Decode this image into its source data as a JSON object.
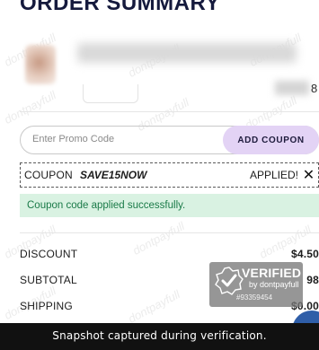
{
  "page": {
    "title": "ORDER SUMMARY"
  },
  "item": {
    "price_visible_digit": "8"
  },
  "promo": {
    "placeholder": "Enter Promo Code",
    "value": "",
    "button_label": "ADD COUPON"
  },
  "coupon": {
    "label": "COUPON",
    "code": "SAVE15NOW",
    "status": "APPLIED!",
    "remove_icon": "close-icon",
    "remove_glyph": "✕"
  },
  "message": {
    "success": "Coupon code applied successfully."
  },
  "summary": {
    "rows": [
      {
        "label": "DISCOUNT",
        "value": "$4.50"
      },
      {
        "label": "SUBTOTAL",
        "value": "98"
      },
      {
        "label": "SHIPPING",
        "value": "$0.00"
      }
    ]
  },
  "badge": {
    "title": "VERIFIED",
    "by": "by dontpayfull",
    "id": "#93359454"
  },
  "watermark": {
    "text": "dontpayfull"
  },
  "footer": {
    "caption": "Snapshot captured during verification."
  },
  "colors": {
    "title": "#151a3d",
    "promo_button_bg": "#e3d3f5",
    "success_bg": "#d9f2e2",
    "success_text": "#1a7a48",
    "footer_bg": "#111111"
  }
}
